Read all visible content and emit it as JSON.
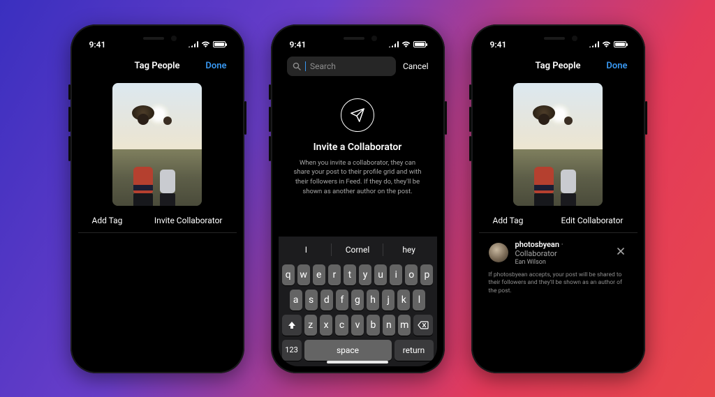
{
  "status": {
    "time": "9:41"
  },
  "colors": {
    "accent": "#3897f0"
  },
  "phone1": {
    "nav_title": "Tag People",
    "done": "Done",
    "add_tag": "Add Tag",
    "invite_collab": "Invite Collaborator"
  },
  "phone2": {
    "search_placeholder": "Search",
    "cancel": "Cancel",
    "invite_title": "Invite a Collaborator",
    "invite_desc": "When you invite a collaborator, they can share your post to their profile grid and with their followers in Feed. If they do, they'll be shown as another author on the post.",
    "suggestions": [
      "I",
      "Cornel",
      "hey"
    ],
    "keys_row1": [
      "q",
      "w",
      "e",
      "r",
      "t",
      "y",
      "u",
      "i",
      "o",
      "p"
    ],
    "keys_row2": [
      "a",
      "s",
      "d",
      "f",
      "g",
      "h",
      "j",
      "k",
      "l"
    ],
    "keys_row3": [
      "z",
      "x",
      "c",
      "v",
      "b",
      "n",
      "m"
    ],
    "key_123": "123",
    "key_space": "space",
    "key_return": "return"
  },
  "phone3": {
    "nav_title": "Tag People",
    "done": "Done",
    "add_tag": "Add Tag",
    "edit_collab": "Edit Collaborator",
    "collab_user": "photosbyean",
    "collab_role": "Collaborator",
    "collab_name": "Ean Wilson",
    "collab_note": "If photosbyean accepts, your post will be shared to their followers and they'll be shown as an author of the post."
  }
}
